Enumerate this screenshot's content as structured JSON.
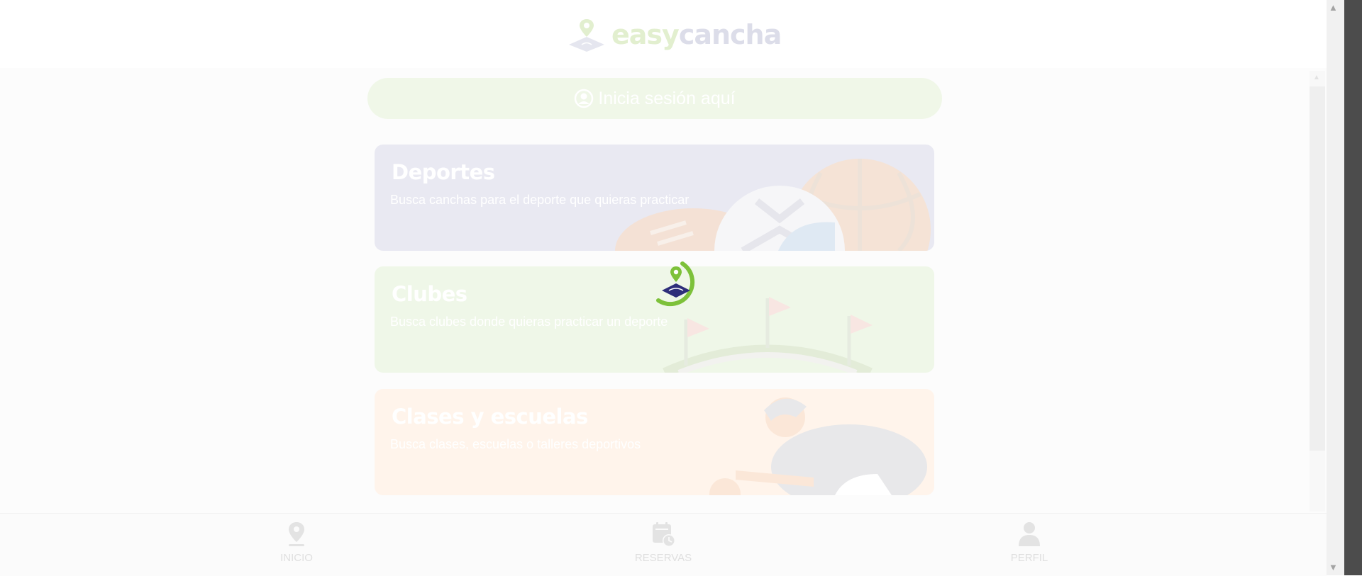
{
  "brand": {
    "part1": "easy",
    "part2": "cancha"
  },
  "login": {
    "label": "Inicia sesión aquí"
  },
  "cards": [
    {
      "title": "Deportes",
      "description": "Busca canchas para el deporte que quieras practicar"
    },
    {
      "title": "Clubes",
      "description": "Busca clubes donde quieras practicar un deporte"
    },
    {
      "title": "Clases y escuelas",
      "description": "Busca clases, escuelas o talleres deportivos"
    }
  ],
  "nav": [
    {
      "label": "INICIO",
      "icon": "location-pin-icon"
    },
    {
      "label": "RESERVAS",
      "icon": "calendar-clock-icon"
    },
    {
      "label": "PERFIL",
      "icon": "user-icon"
    }
  ],
  "loader": {
    "icon": "loading-spinner-icon"
  },
  "colors": {
    "brand_green": "#7dc13a",
    "brand_navy": "#2e2e7a",
    "sports_card": "#e9e9f2",
    "clubs_card": "#eff7e8",
    "classes_card": "#fff4eb"
  }
}
